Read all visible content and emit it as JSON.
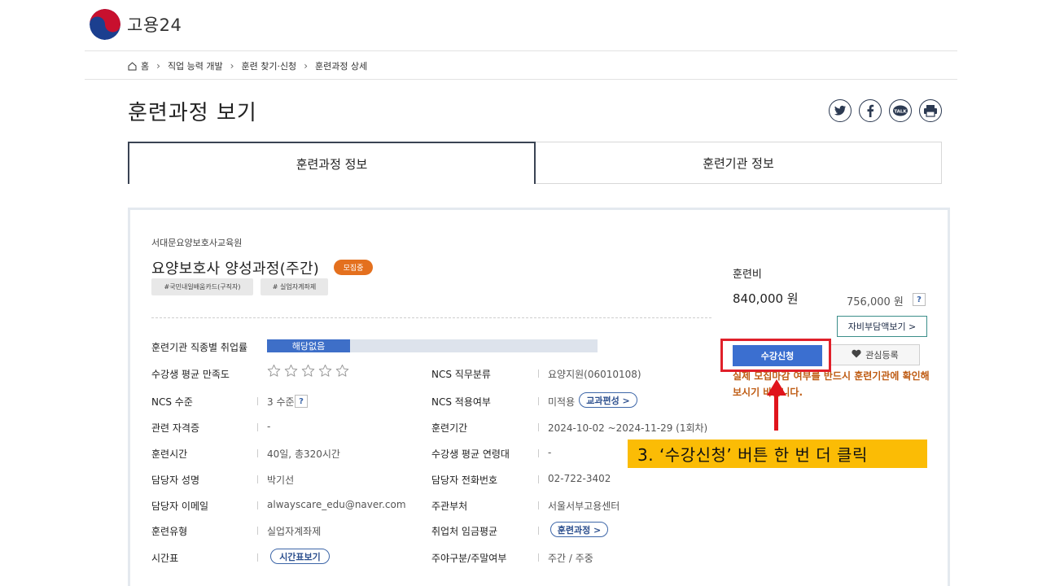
{
  "site": {
    "logo_text": "고용24"
  },
  "breadcrumb": {
    "home": "홈",
    "items": [
      "직업 능력 개발",
      "훈련 찾기·신청",
      "훈련과정 상세"
    ]
  },
  "page": {
    "title": "훈련과정 보기"
  },
  "share_icons": [
    "twitter-icon",
    "facebook-icon",
    "kakaotalk-icon",
    "print-icon"
  ],
  "tabs": [
    {
      "label": "훈련과정 정보",
      "active": true
    },
    {
      "label": "훈련기관 정보",
      "active": false
    }
  ],
  "course": {
    "institution": "서대문요양보호사교육원",
    "title": "요양보호사 양성과정(주간)",
    "status_badge": "모집중",
    "tags": [
      "#국민내일배움카드(구직자)",
      "# 실업자계좌제"
    ]
  },
  "details": {
    "employment_rate": {
      "label": "훈련기관 직종별 취업률",
      "value": "해당없음",
      "fill_percent": 25
    },
    "satisfaction": {
      "label": "수강생 평균 만족도",
      "stars_filled": 0,
      "stars_total": 5
    },
    "ncs_level": {
      "label": "NCS 수준",
      "value": "3 수준",
      "help": "?"
    },
    "certificate": {
      "label": "관련 자격증",
      "value": "-"
    },
    "training_hours": {
      "label": "훈련시간",
      "value": "40일, 총320시간"
    },
    "manager_name": {
      "label": "담당자 성명",
      "value": "박기선"
    },
    "manager_email": {
      "label": "담당자 이메일",
      "value": "alwayscare_edu@naver.com"
    },
    "training_type": {
      "label": "훈련유형",
      "value": "실업자계좌제"
    },
    "timetable": {
      "label": "시간표",
      "button": "시간표보기"
    },
    "ncs_category": {
      "label": "NCS 직무분류",
      "value": "요양지원(06010108)"
    },
    "ncs_applied": {
      "label": "NCS 적용여부",
      "value": "미적용",
      "button": "교과편성 >"
    },
    "period": {
      "label": "훈련기간",
      "value": "2024-10-02 ~2024-11-29 (1회차)"
    },
    "avg_age": {
      "label": "수강생 평균 연령대",
      "value": "-"
    },
    "manager_phone": {
      "label": "담당자 전화번호",
      "value": "02-722-3402"
    },
    "dept": {
      "label": "주관부처",
      "value": "서울서부고용센터"
    },
    "avg_wage": {
      "label": "취업처 임금평균",
      "button": "훈련과정 >"
    },
    "day_type": {
      "label": "주야구분/주말여부",
      "value": "주간 / 주중"
    }
  },
  "fee": {
    "label": "훈련비",
    "main": "840,000 원",
    "sub": "756,000 원",
    "help": "?",
    "self_pay_button": "자비부담액보기 >"
  },
  "actions": {
    "apply_button": "수강신청",
    "favorite_button": "관심등록",
    "notice": "실제 모집마감 여부를 반드시 훈련기관에 확인해보시기 바랍니다."
  },
  "annotation": {
    "callout": "3. ‘수강신청’ 버튼 한 번 더 클릭",
    "highlight_color": "#e0202a",
    "callout_color": "#fbbc05"
  }
}
